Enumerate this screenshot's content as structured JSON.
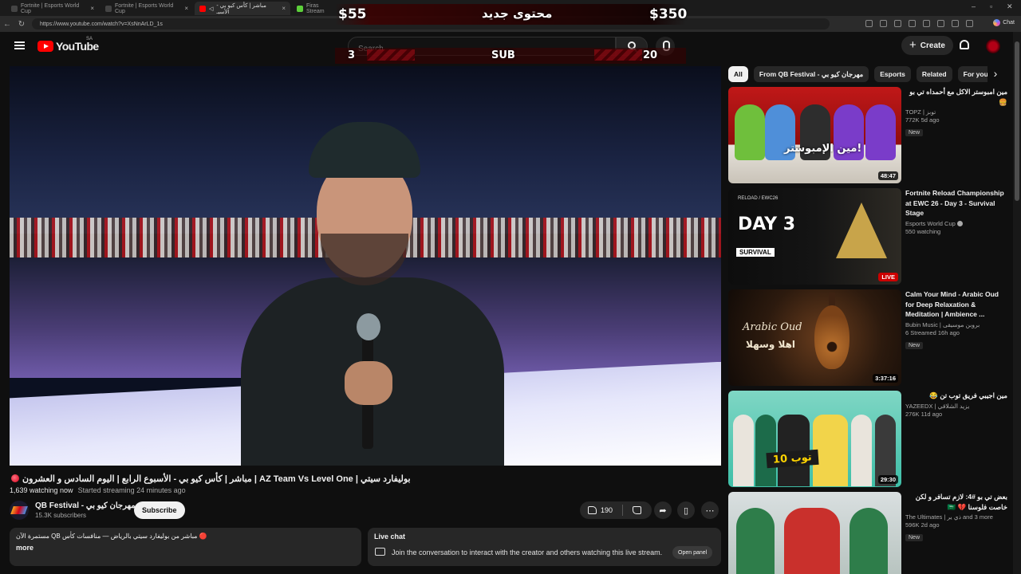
{
  "browser": {
    "tabs": [
      {
        "title": "Fortnite | Esports World Cup"
      },
      {
        "title": "Fortnite | Esports World Cup"
      },
      {
        "title": "مباشر | كأس كيو بي - الأسبـ"
      },
      {
        "title": "Firas Stream"
      }
    ],
    "url": "https://www.youtube.com/watch?v=XsNnArLD_1s",
    "chat_label": "Chat"
  },
  "overlay": {
    "left_amount": "$55",
    "center_text": "محتوى جديد",
    "right_amount": "$350",
    "left_count": "3",
    "sub_label": "SUB",
    "right_count": "20"
  },
  "header": {
    "logo_text": "YouTube",
    "country_code": "SA",
    "search_placeholder": "Search",
    "create_label": "Create"
  },
  "video": {
    "title": "بوليفارد سيتي | AZ Team Vs Level One | مباشر | كأس كيو بي - الأسبوع الرابع | اليوم السادس و العشرون",
    "watching": "1,639 watching now",
    "started": "Started streaming 24 minutes ago",
    "channel_name": "QB Festival - مهرجان كيو بي",
    "subscribers": "15.3K subscribers",
    "subscribe_label": "Subscribe",
    "likes": "190",
    "description": "🔴 مباشر من بوليفارد سيتي بالرياض — منافسات كأس QB مستمرة الآن",
    "more_label": "more"
  },
  "live_chat": {
    "title": "Live chat",
    "prompt": "Join the conversation to interact with the creator and others watching this live stream.",
    "open_panel_label": "Open panel"
  },
  "chips": [
    "All",
    "From QB Festival - مهرجان كيو بي",
    "Esports",
    "Related",
    "For you"
  ],
  "recommendations": [
    {
      "title": "مين امبوستر الاكل مع أحمداه تي بو 🍔",
      "channel": "TOPZ | توبز",
      "views": "772K",
      "age": "5d ago",
      "badge": "New",
      "duration": "48:47",
      "thumb_text": "مين الإمبوستر!"
    },
    {
      "title": "Fortnite Reload Championship at EWC 26 - Day 3 - Survival Stage",
      "channel": "Esports World Cup",
      "views": "550 watching",
      "age": "",
      "badge": "",
      "duration": "LIVE",
      "thumb_text": "DAY 3",
      "thumb_sub": "SURVIVAL",
      "thumb_brand": "RELOAD / EWC26"
    },
    {
      "title": "Calm Your Mind - Arabic Oud for Deep Relaxation & Meditation | Ambience ...",
      "channel": "Bubin Music | بروبن موسيقى",
      "views": "6",
      "age": "Streamed 16h ago",
      "badge": "New",
      "duration": "3:37:16",
      "thumb_text": "Arabic Oud",
      "thumb_sub": "اهلا وسهلا"
    },
    {
      "title": "مين اجيبي فريق توب تن 😂",
      "channel": "YAZEEDX | يزيد الشلاقي",
      "views": "276K",
      "age": "11d ago",
      "badge": "",
      "duration": "29:30",
      "thumb_text": "توب 10"
    },
    {
      "title": "بعض تي بو #4: لازم تسافر و لكن خاصت فلوسنا 💔 🇸🇦",
      "channel": "The Ultimates | ذي ير and 3 more",
      "views": "596K",
      "age": "2d ago",
      "badge": "New",
      "duration": "",
      "thumb_text": ""
    }
  ],
  "colors": {
    "accent": "#ff0000",
    "bg": "#0f0f0f",
    "surface": "#272727",
    "live": "#cc0000"
  }
}
